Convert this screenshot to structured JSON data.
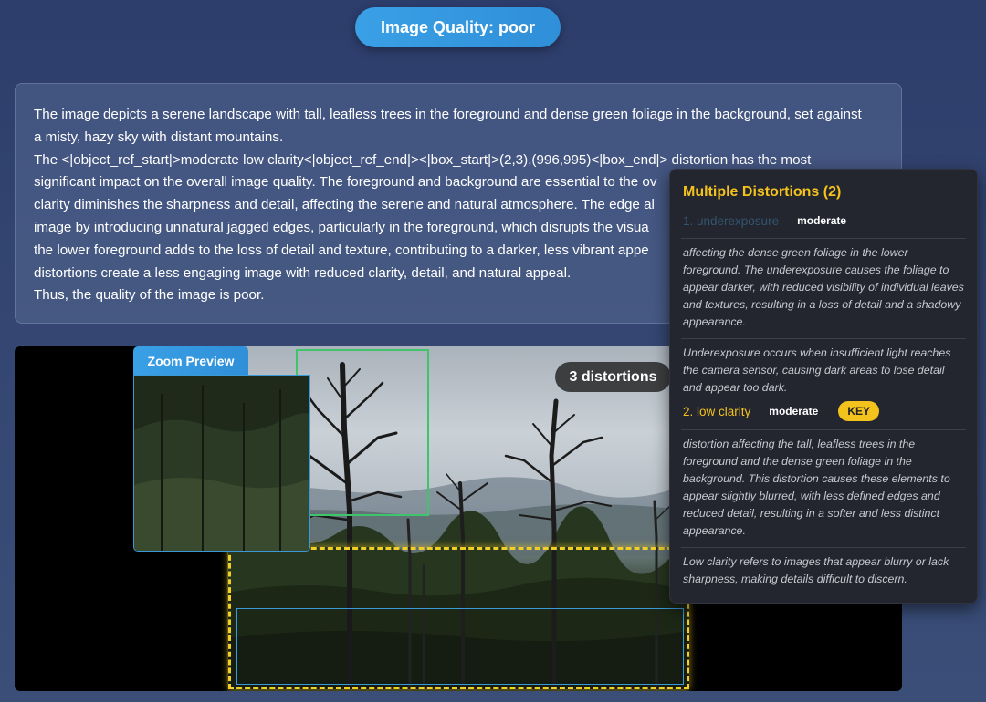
{
  "header": {
    "quality_label": "Image Quality: poor"
  },
  "description": {
    "lines": [
      "The image depicts a serene landscape with tall, leafless trees in the foreground and dense green foliage in the background, set against",
      "a misty, hazy sky with distant mountains.",
      "The <|object_ref_start|>moderate low clarity<|object_ref_end|><|box_start|>(2,3),(996,995)<|box_end|> distortion has the most",
      "significant impact on the overall image quality. The foreground and background are essential to the ov",
      "clarity diminishes the sharpness and detail, affecting the serene and natural atmosphere. The edge al",
      "image by introducing unnatural jagged edges, particularly in the foreground, which disrupts the visua",
      "the lower foreground adds to the loss of detail and texture, contributing to a darker, less vibrant appe",
      "distortions create a less engaging image with reduced clarity, detail, and natural appeal.",
      "Thus, the quality of the image is poor."
    ]
  },
  "viewer": {
    "zoom_label": "Zoom Preview",
    "distortion_count": "3 distortions"
  },
  "popup": {
    "title": "Multiple Distortions (2)",
    "items": [
      {
        "label": "1. underexposure",
        "severity": "moderate",
        "description": "affecting the dense green foliage in the lower foreground. The underexposure causes the foliage to appear darker, with reduced visibility of individual leaves and textures, resulting in a loss of detail and a shadowy appearance.",
        "definition": "Underexposure occurs when insufficient light reaches the camera sensor, causing dark areas to lose detail and appear too dark."
      },
      {
        "label": "2. low clarity",
        "severity": "moderate",
        "badge": "KEY",
        "description": "distortion affecting the tall, leafless trees in the foreground and the dense green foliage in the background. This distortion causes these elements to appear slightly blurred, with less defined edges and reduced detail, resulting in a softer and less distinct appearance.",
        "definition": "Low clarity refers to images that appear blurry or lack sharpness, making details difficult to discern."
      }
    ]
  },
  "colors": {
    "accent_blue": "#3aa0e6",
    "key_yellow": "#f4c21c",
    "box_green": "#3ec46a",
    "box_yellow": "#f2cf26"
  }
}
